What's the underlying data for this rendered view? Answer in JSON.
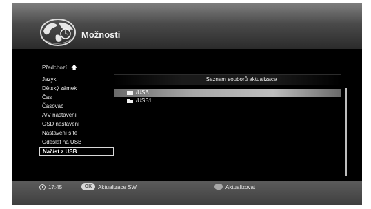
{
  "header": {
    "title": "Možnosti"
  },
  "menu": {
    "prev_label": "Předchozí",
    "items": [
      "Jazyk",
      "Dětský zámek",
      "Čas",
      "Časovač",
      "A/V nastavení",
      "OSD nastavení",
      "Nastavení sítě",
      "Odeslat na USB",
      "Načíst z USB"
    ],
    "selected": "Načíst z USB"
  },
  "panel": {
    "title": "Seznam souborů aktualizace",
    "files": [
      "/USB",
      "/USB1"
    ],
    "selected_file": "/USB"
  },
  "footer": {
    "time": "17:45",
    "ok_key": "OK",
    "ok_action": "Aktualizace SW",
    "red_action": "Aktualizovat"
  }
}
